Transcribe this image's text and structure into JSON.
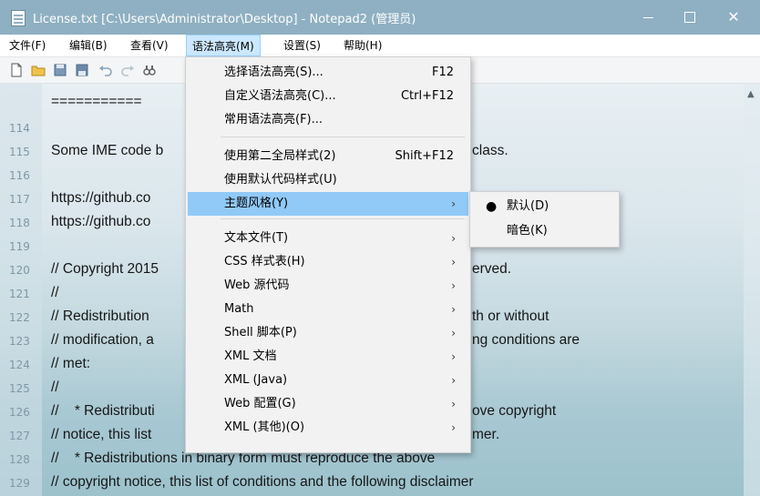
{
  "window": {
    "title": "License.txt [C:\\Users\\Administrator\\Desktop] - Notepad2 (管理员)",
    "minimize_glyph": "",
    "close_glyph": "✕"
  },
  "menubar": {
    "items": [
      "文件(F)",
      "编辑(B)",
      "查看(V)",
      "语法高亮(M)",
      "设置(S)",
      "帮助(H)"
    ]
  },
  "editor": {
    "lines": [
      {
        "num": "",
        "text": "==========="
      },
      {
        "num": "114",
        "text": ""
      },
      {
        "num": "115",
        "text": "Some IME code b"
      },
      {
        "num": "116",
        "text": ""
      },
      {
        "num": "117",
        "text": "https://github.co"
      },
      {
        "num": "118",
        "text": "https://github.co"
      },
      {
        "num": "119",
        "text": ""
      },
      {
        "num": "120",
        "text": "// Copyright 2015"
      },
      {
        "num": "121",
        "text": "//"
      },
      {
        "num": "122",
        "text": "// Redistribution"
      },
      {
        "num": "123",
        "text": "// modification, a"
      },
      {
        "num": "124",
        "text": "// met:"
      },
      {
        "num": "125",
        "text": "//"
      },
      {
        "num": "126",
        "text": "//    * Redistributi"
      },
      {
        "num": "127",
        "text": "// notice, this list"
      },
      {
        "num": "128",
        "text": "//    * Redistributions in binary form must reproduce the above"
      },
      {
        "num": "129",
        "text": "// copyright notice, this list of conditions and the following disclaimer"
      }
    ],
    "right_fragments": [
      {
        "text": "class.",
        "line": 2
      },
      {
        "text": "erved.",
        "line": 7
      },
      {
        "text": "th or without",
        "line": 9
      },
      {
        "text": "ng conditions are",
        "line": 10
      },
      {
        "text": "ove copyright",
        "line": 13
      },
      {
        "text": "mer.",
        "line": 14
      }
    ]
  },
  "syntax_menu": {
    "items": [
      {
        "label": "选择语法高亮(S)...",
        "shortcut": "F12"
      },
      {
        "label": "自定义语法高亮(C)...",
        "shortcut": "Ctrl+F12"
      },
      {
        "label": "常用语法高亮(F)...",
        "shortcut": ""
      },
      {
        "label": "使用第二全局样式(2)",
        "shortcut": "Shift+F12"
      },
      {
        "label": "使用默认代码样式(U)",
        "shortcut": ""
      },
      {
        "label": "主题风格(Y)",
        "shortcut": "",
        "submenu": true
      },
      {
        "label": "文本文件(T)",
        "submenu": true
      },
      {
        "label": "CSS 样式表(H)",
        "submenu": true
      },
      {
        "label": "Web 源代码",
        "submenu": true
      },
      {
        "label": "Math",
        "submenu": true
      },
      {
        "label": "Shell 脚本(P)",
        "submenu": true
      },
      {
        "label": "XML 文档",
        "submenu": true
      },
      {
        "label": "XML (Java)",
        "submenu": true
      },
      {
        "label": "Web 配置(G)",
        "submenu": true
      },
      {
        "label": "XML (其他)(O)",
        "submenu": true
      }
    ],
    "arrow_glyph": "›"
  },
  "theme_submenu": {
    "items": [
      {
        "label": "默认(D)",
        "checked": true
      },
      {
        "label": "暗色(K)",
        "checked": false
      }
    ],
    "bullet_glyph": "●"
  },
  "colors": {
    "titlebar": "#8fb0c2",
    "menu_highlight": "#91c9f7",
    "menubar_active": "#cce8ff"
  }
}
